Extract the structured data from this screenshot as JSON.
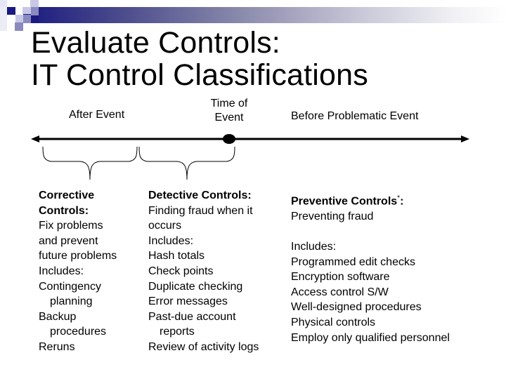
{
  "slide": {
    "title_line1": "Evaluate Controls:",
    "title_line2": "IT Control Classifications",
    "theme_colors": {
      "dark_blue": "#1a1a80",
      "mid_blue": "#8a8ac0",
      "light_blue": "#c8c8e6"
    }
  },
  "timeline": {
    "after_label": "After Event",
    "time_label_line1": "Time of",
    "time_label_line2": "Event",
    "before_label": "Before Problematic Event"
  },
  "columns": {
    "corrective": {
      "heading_line1": "Corrective",
      "heading_line2": "Controls:",
      "lines": [
        {
          "text": "Fix problems",
          "indent": false
        },
        {
          "text": "and prevent",
          "indent": false
        },
        {
          "text": "future problems",
          "indent": false
        },
        {
          "text": "Includes:",
          "indent": false
        },
        {
          "text": "Contingency",
          "indent": false
        },
        {
          "text": "planning",
          "indent": true
        },
        {
          "text": "Backup",
          "indent": false
        },
        {
          "text": "procedures",
          "indent": true
        },
        {
          "text": "Reruns",
          "indent": false
        }
      ]
    },
    "detective": {
      "heading": "Detective Controls:",
      "lines": [
        {
          "text": "Finding fraud when it",
          "indent": false
        },
        {
          "text": "occurs",
          "indent": false
        },
        {
          "text": "Includes:",
          "indent": false
        },
        {
          "text": "Hash totals",
          "indent": false
        },
        {
          "text": "Check points",
          "indent": false
        },
        {
          "text": "Duplicate checking",
          "indent": false
        },
        {
          "text": "Error messages",
          "indent": false
        },
        {
          "text": "Past-due account",
          "indent": false
        },
        {
          "text": "reports",
          "indent": true
        },
        {
          "text": "Review of activity logs",
          "indent": false
        }
      ]
    },
    "preventive": {
      "heading": "Preventive Controls",
      "heading_mark": "*",
      "heading_colon": ":",
      "lines": [
        {
          "text": "Preventing fraud",
          "indent": false
        },
        {
          "text": "",
          "indent": false
        },
        {
          "text": "Includes:",
          "indent": false
        },
        {
          "text": "Programmed edit checks",
          "indent": false
        },
        {
          "text": "Encryption software",
          "indent": false
        },
        {
          "text": "Access control S/W",
          "indent": false
        },
        {
          "text": "Well-designed procedures",
          "indent": false
        },
        {
          "text": "Physical controls",
          "indent": false
        },
        {
          "text": "Employ only qualified personnel",
          "indent": false
        }
      ]
    }
  }
}
